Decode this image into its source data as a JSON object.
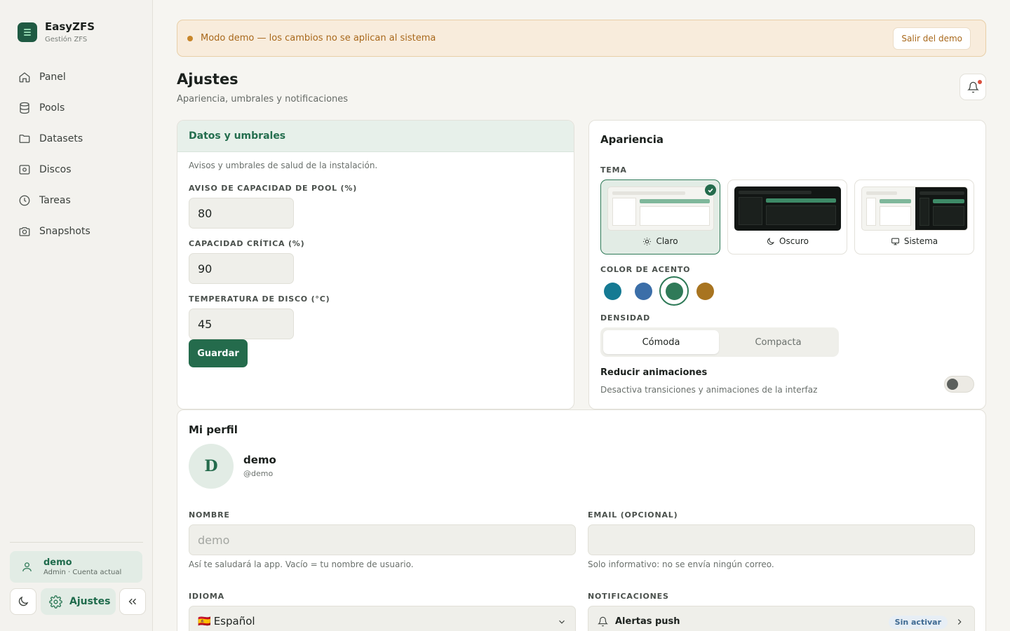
{
  "brand": {
    "title": "EasyZFS",
    "subtitle": "Gestión ZFS"
  },
  "sidebar": {
    "items": [
      {
        "label": "Panel",
        "icon": "home-icon"
      },
      {
        "label": "Pools",
        "icon": "database-icon"
      },
      {
        "label": "Datasets",
        "icon": "folder-icon"
      },
      {
        "label": "Discos",
        "icon": "disk-icon"
      },
      {
        "label": "Tareas",
        "icon": "clock-icon"
      },
      {
        "label": "Snapshots",
        "icon": "camera-icon"
      }
    ],
    "user": {
      "name": "demo",
      "role": "Admin · Cuenta actual"
    },
    "settings_label": "Ajustes"
  },
  "banner": {
    "text": "Modo demo — los cambios no se aplican al sistema",
    "button": "Salir del demo"
  },
  "header": {
    "title": "Ajustes",
    "subtitle": "Apariencia, umbrales y notificaciones"
  },
  "thresholds": {
    "title": "Datos y umbrales",
    "description": "Avisos y umbrales de salud de la instalación.",
    "fields": [
      {
        "label": "AVISO DE CAPACIDAD DE POOL (%)",
        "value": "80"
      },
      {
        "label": "CAPACIDAD CRÍTICA (%)",
        "value": "90"
      },
      {
        "label": "TEMPERATURA DE DISCO (°C)",
        "value": "45"
      }
    ],
    "save_label": "Guardar"
  },
  "appearance": {
    "title": "Apariencia",
    "theme_label": "TEMA",
    "themes": [
      {
        "label": "Claro",
        "selected": true
      },
      {
        "label": "Oscuro",
        "selected": false
      },
      {
        "label": "Sistema",
        "selected": false
      }
    ],
    "accent_label": "COLOR DE ACENTO",
    "accents": [
      "#157a93",
      "#3b6ea8",
      "#2f7a58",
      "#a87420"
    ],
    "accent_selected": 2,
    "density_label": "DENSIDAD",
    "density_options": [
      "Cómoda",
      "Compacta"
    ],
    "density_selected": 0,
    "reduce_motion": {
      "title": "Reducir animaciones",
      "description": "Desactiva transiciones y animaciones de la interfaz",
      "enabled": false
    }
  },
  "profile": {
    "title": "Mi perfil",
    "avatar_letter": "D",
    "name": "demo",
    "handle": "@demo",
    "name_label": "NOMBRE",
    "name_placeholder": "demo",
    "name_help": "Así te saludará la app. Vacío = tu nombre de usuario.",
    "email_label": "EMAIL (OPCIONAL)",
    "email_value": "",
    "email_help": "Solo informativo: no se envía ningún correo.",
    "language_label": "IDIOMA",
    "language_flag": "🇪🇸",
    "language_value": "Español",
    "notifications_label": "NOTIFICACIONES",
    "push_label": "Alertas push",
    "push_status": "Sin activar"
  },
  "colors": {
    "accent": "#246b4c",
    "banner_text": "#a8681b"
  }
}
